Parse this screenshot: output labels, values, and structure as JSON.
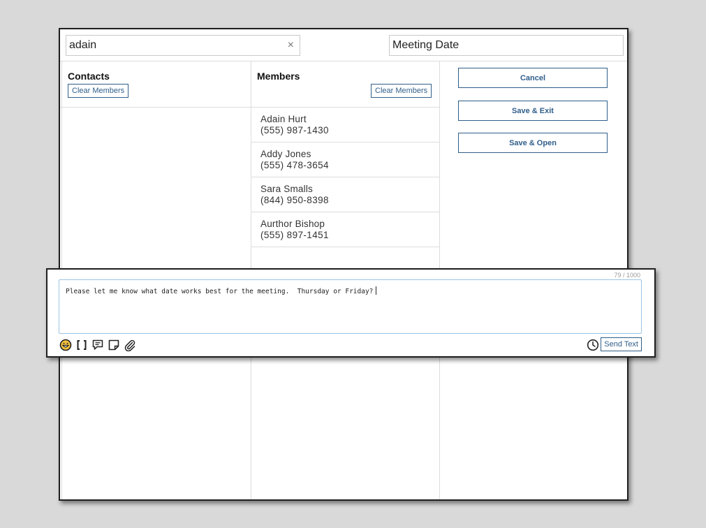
{
  "search": {
    "value": "adain",
    "clear_icon": "×"
  },
  "title_field": {
    "value": "Meeting Date"
  },
  "contacts": {
    "heading": "Contacts",
    "clear_label": "Clear Members"
  },
  "members": {
    "heading": "Members",
    "clear_label": "Clear Members",
    "items": [
      {
        "name": "Adain Hurt",
        "phone": "(555) 987-1430"
      },
      {
        "name": "Addy Jones",
        "phone": "(555) 478-3654"
      },
      {
        "name": "Sara Smalls",
        "phone": "(844) 950-8398"
      },
      {
        "name": "Aurthor Bishop",
        "phone": "(555) 897-1451"
      }
    ]
  },
  "actions": {
    "cancel": "Cancel",
    "save_exit": "Save & Exit",
    "save_open": "Save & Open"
  },
  "composer": {
    "char_count": "79 / 1000",
    "message": "Please let me know what date works best for the meeting.  Thursday or Friday?",
    "send_label": "Send Text",
    "icons": [
      "emoji-icon",
      "brackets-icon",
      "chat-icon",
      "note-icon",
      "attachment-icon",
      "clock-icon"
    ]
  },
  "colors": {
    "accent": "#2f5e8a",
    "focus_border": "#9cc4e4",
    "backdrop": "#d9d9d9"
  }
}
